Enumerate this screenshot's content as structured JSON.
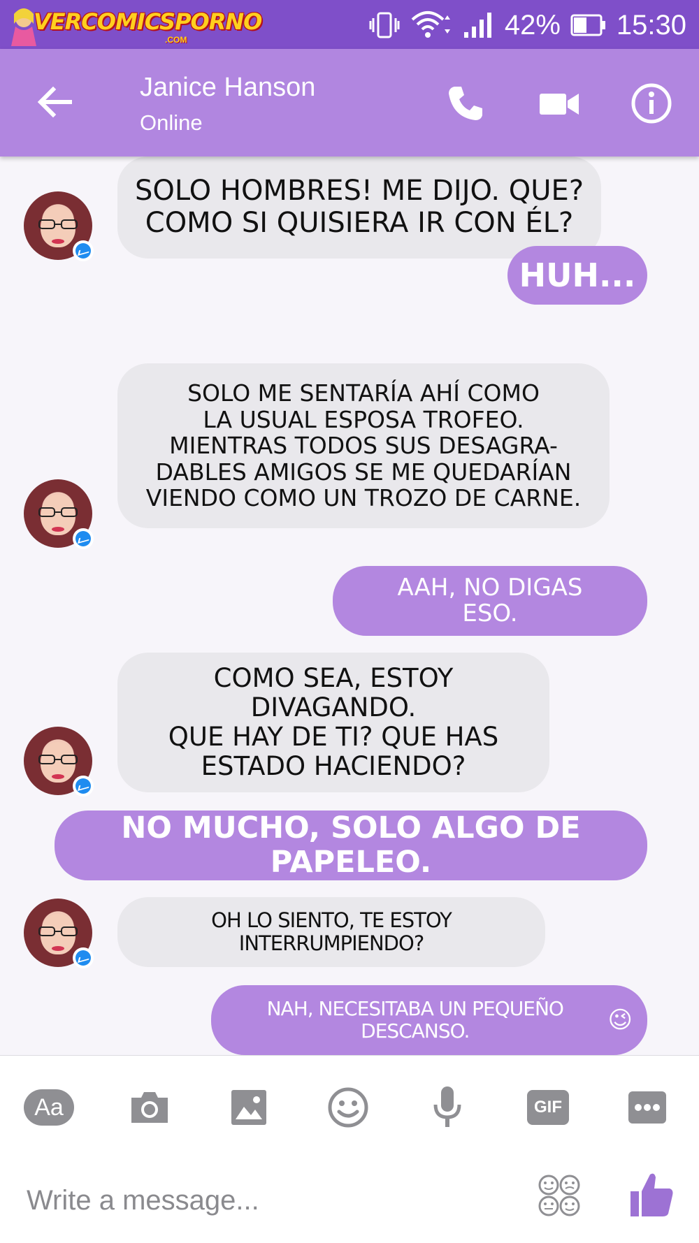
{
  "status_bar": {
    "logo_text": "VERCOMICSPORNO",
    "logo_suffix": ".COM",
    "battery": "42%",
    "time": "15:30"
  },
  "header": {
    "contact_name": "Janice Hanson",
    "contact_status": "Online"
  },
  "messages": [
    {
      "side": "in",
      "text": "SOLO HOMBRES! ME DIJO. QUE?\nCOMO SI QUISIERA IR CON ÉL?"
    },
    {
      "side": "out",
      "text": "HUH..."
    },
    {
      "side": "in",
      "text": "SOLO ME SENTARÍA AHÍ COMO\nLA USUAL ESPOSA TROFEO.\nMIENTRAS TODOS SUS DESAGRA-\nDABLES AMIGOS SE ME QUEDARÍAN\nVIENDO COMO UN TROZO DE CARNE."
    },
    {
      "side": "out",
      "text": "AAH, NO DIGAS\nESO."
    },
    {
      "side": "in",
      "text": "COMO SEA, ESTOY DIVAGANDO.\nQUE HAY DE TI? QUE HAS\nESTADO HACIENDO?"
    },
    {
      "side": "out",
      "text": "NO MUCHO, SOLO ALGO DE PAPELEO."
    },
    {
      "side": "in",
      "text": "OH LO SIENTO, TE ESTOY INTERRUMPIENDO?"
    },
    {
      "side": "out",
      "text": "NAH, NECESITABA UN PEQUEÑO DESCANSO.",
      "emoji": "😉"
    }
  ],
  "composer": {
    "aa_label": "Aa",
    "gif_label": "GIF",
    "placeholder": "Write a message..."
  },
  "colors": {
    "status_bar": "#7f4fc9",
    "header": "#b186e0",
    "outgoing_bubble": "#b387e0",
    "incoming_bubble": "#e9e8ec",
    "icon_gray": "#8f8f93",
    "like_purple": "#9d72d4"
  },
  "icons": [
    "back-arrow",
    "phone",
    "video-camera",
    "info",
    "camera",
    "image",
    "emoji",
    "microphone",
    "more",
    "stickers",
    "thumbs-up"
  ]
}
